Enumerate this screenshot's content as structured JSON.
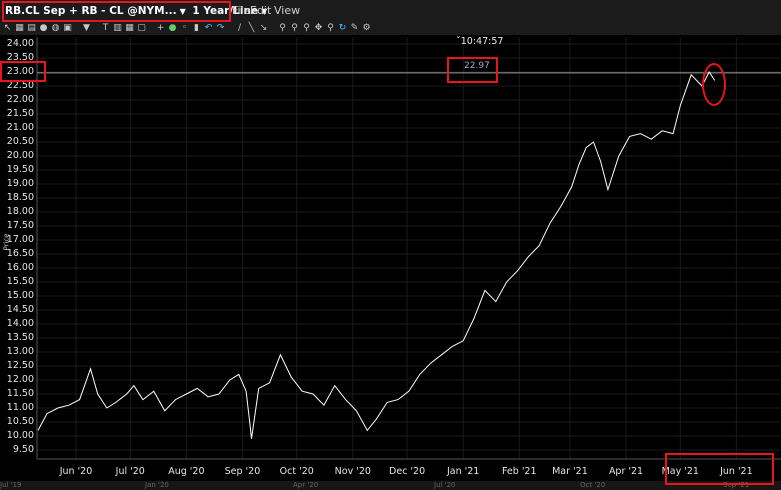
{
  "header": {
    "symbol_text": "RB.CL Sep + RB - CL @NYM...",
    "interval_text": "1 Year/Line",
    "menu": [
      "File",
      "Edit",
      "View"
    ]
  },
  "toolbar": {
    "icons": [
      "pointer-icon",
      "bars-icon",
      "grid-icon",
      "circle-icon",
      "globe-icon",
      "window-icon",
      "gap-icon",
      "filter-icon",
      "gap2-icon",
      "text-icon",
      "list-icon",
      "table-icon",
      "box-icon",
      "gap3-icon",
      "crosshair-icon",
      "dot-icon",
      "draw-icon",
      "bold-icon",
      "undo-icon",
      "redo-icon",
      "gap4-icon",
      "line-tool-icon",
      "slash-icon",
      "arrow-icon",
      "gap5-icon",
      "zoom-in-icon",
      "zoom-out-icon",
      "zoom-fit-icon",
      "pan-icon",
      "zoom-icon",
      "refresh-icon",
      "pencil-icon",
      "settings-icon"
    ]
  },
  "chart_data": {
    "type": "line",
    "ylabel": "Price",
    "y_ticks": [
      "24.00",
      "23.50",
      "23.00",
      "22.50",
      "22.00",
      "21.50",
      "21.00",
      "20.50",
      "20.00",
      "19.50",
      "19.00",
      "18.50",
      "18.00",
      "17.50",
      "17.00",
      "16.50",
      "16.00",
      "15.50",
      "15.00",
      "14.50",
      "14.00",
      "13.50",
      "13.00",
      "12.50",
      "12.00",
      "11.50",
      "11.00",
      "10.50",
      "10.00",
      "9.50"
    ],
    "ylim": [
      9.5,
      24.0
    ],
    "x_ticks": [
      "Jun '20",
      "Jul '20",
      "Aug '20",
      "Sep '20",
      "Oct '20",
      "Nov '20",
      "Dec '20",
      "Jan '21",
      "Feb '21",
      "Mar '21",
      "Apr '21",
      "May '21",
      "Jun '21"
    ],
    "x_tick_dates": [
      "2020-06-01",
      "2020-07-01",
      "2020-08-01",
      "2020-09-01",
      "2020-10-01",
      "2020-11-01",
      "2020-12-01",
      "2021-01-01",
      "2021-02-01",
      "2021-03-01",
      "2021-04-01",
      "2021-05-01",
      "2021-06-01"
    ],
    "xlim": [
      "2020-05-11",
      "2021-06-24"
    ],
    "crosshair_price": "22.97",
    "crosshair_time": "10:47:57",
    "series": [
      {
        "x": [
          "2020-05-11",
          "2020-05-16",
          "2020-05-22",
          "2020-05-28",
          "2020-06-03",
          "2020-06-09",
          "2020-06-13",
          "2020-06-18",
          "2020-06-23",
          "2020-06-29",
          "2020-07-03",
          "2020-07-08",
          "2020-07-14",
          "2020-07-20",
          "2020-07-26",
          "2020-08-01",
          "2020-08-07",
          "2020-08-13",
          "2020-08-19",
          "2020-08-25",
          "2020-08-30",
          "2020-09-03",
          "2020-09-05",
          "2020-09-06",
          "2020-09-10",
          "2020-09-16",
          "2020-09-22",
          "2020-09-28",
          "2020-10-04",
          "2020-10-10",
          "2020-10-16",
          "2020-10-22",
          "2020-10-28",
          "2020-11-03",
          "2020-11-09",
          "2020-11-14",
          "2020-11-20",
          "2020-11-26",
          "2020-12-02",
          "2020-12-08",
          "2020-12-14",
          "2020-12-20",
          "2020-12-26",
          "2021-01-01",
          "2021-01-07",
          "2021-01-13",
          "2021-01-19",
          "2021-01-25",
          "2021-01-31",
          "2021-02-06",
          "2021-02-12",
          "2021-02-18",
          "2021-02-24",
          "2021-03-02",
          "2021-03-06",
          "2021-03-10",
          "2021-03-14",
          "2021-03-18",
          "2021-03-22",
          "2021-03-28",
          "2021-04-03",
          "2021-04-09",
          "2021-04-15",
          "2021-04-21",
          "2021-04-27",
          "2021-05-01",
          "2021-05-07",
          "2021-05-13",
          "2021-05-17",
          "2021-05-20"
        ],
        "y": [
          10.2,
          10.8,
          11.0,
          11.1,
          11.3,
          12.4,
          11.5,
          11.0,
          11.2,
          11.5,
          11.8,
          11.3,
          11.6,
          10.9,
          11.3,
          11.5,
          11.7,
          11.4,
          11.5,
          12.0,
          12.2,
          11.6,
          10.5,
          9.9,
          11.7,
          11.9,
          12.9,
          12.1,
          11.6,
          11.5,
          11.1,
          11.8,
          11.3,
          10.9,
          10.2,
          10.6,
          11.2,
          11.3,
          11.6,
          12.2,
          12.6,
          12.9,
          13.2,
          13.4,
          14.2,
          15.2,
          14.8,
          15.5,
          15.9,
          16.4,
          16.8,
          17.6,
          18.2,
          18.9,
          19.7,
          20.3,
          20.5,
          19.8,
          18.8,
          20.0,
          20.7,
          20.8,
          20.6,
          20.9,
          20.8,
          21.8,
          22.9,
          22.5,
          23.0,
          22.7
        ]
      }
    ]
  },
  "bottom_strip": {
    "labels": [
      "Jul '19",
      "Jan '20",
      "Apr '20",
      "Jul '20",
      "Oct '20",
      "Sep '21"
    ]
  }
}
